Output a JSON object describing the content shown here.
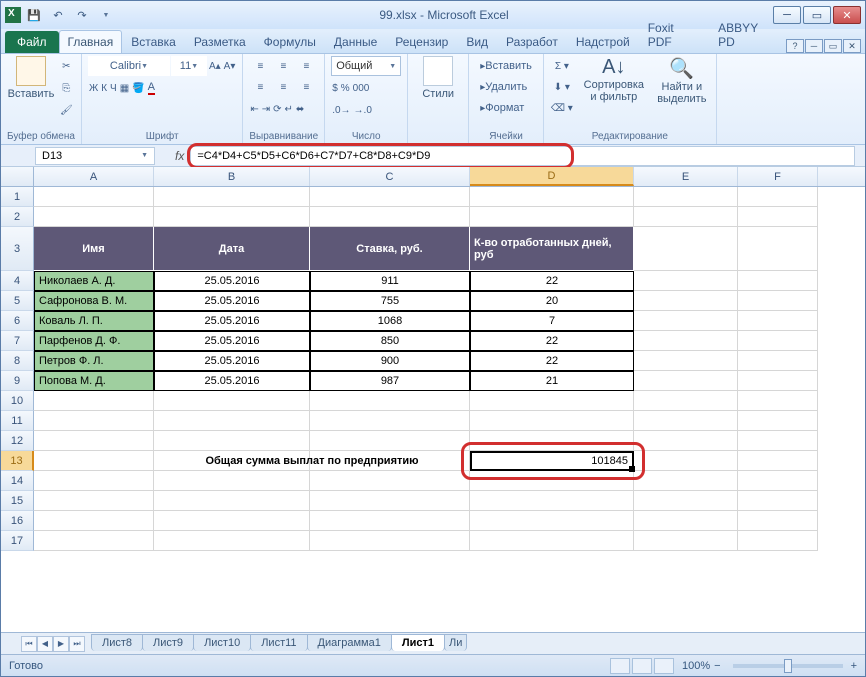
{
  "window": {
    "title": "99.xlsx - Microsoft Excel"
  },
  "qat": {
    "save": "💾",
    "undo": "↶",
    "redo": "↷"
  },
  "ribbon": {
    "file": "Файл",
    "tabs": [
      "Главная",
      "Вставка",
      "Разметка",
      "Формулы",
      "Данные",
      "Рецензир",
      "Вид",
      "Разработ",
      "Надстрой",
      "Foxit PDF",
      "ABBYY PD"
    ],
    "active": "Главная",
    "clipboard": {
      "paste": "Вставить",
      "label": "Буфер обмена"
    },
    "font": {
      "name": "Calibri",
      "size": "11",
      "label": "Шрифт",
      "bold": "Ж",
      "italic": "К",
      "under": "Ч"
    },
    "align": {
      "label": "Выравнивание"
    },
    "number": {
      "format": "Общий",
      "label": "Число"
    },
    "styles": {
      "btn": "Стили",
      "label": ""
    },
    "cells": {
      "insert": "Вставить",
      "delete": "Удалить",
      "format": "Формат",
      "label": "Ячейки"
    },
    "editing": {
      "sort": "Сортировка и фильтр",
      "find": "Найти и выделить",
      "label": "Редактирование"
    }
  },
  "namebox": "D13",
  "formula": "=C4*D4+C5*D5+C6*D6+C7*D7+C8*D8+C9*D9",
  "columns": [
    "A",
    "B",
    "C",
    "D",
    "E",
    "F"
  ],
  "table": {
    "headers": {
      "a": "Имя",
      "b": "Дата",
      "c": "Ставка, руб.",
      "d": "К-во отработанных дней, руб"
    },
    "rows": [
      {
        "a": "Николаев А. Д.",
        "b": "25.05.2016",
        "c": "911",
        "d": "22"
      },
      {
        "a": "Сафронова В. М.",
        "b": "25.05.2016",
        "c": "755",
        "d": "20"
      },
      {
        "a": "Коваль Л. П.",
        "b": "25.05.2016",
        "c": "1068",
        "d": "7"
      },
      {
        "a": "Парфенов Д. Ф.",
        "b": "25.05.2016",
        "c": "850",
        "d": "22"
      },
      {
        "a": "Петров Ф. Л.",
        "b": "25.05.2016",
        "c": "900",
        "d": "22"
      },
      {
        "a": "Попова М. Д.",
        "b": "25.05.2016",
        "c": "987",
        "d": "21"
      }
    ],
    "total_label": "Общая сумма выплат по предприятию",
    "total_value": "101845"
  },
  "sheets": {
    "tabs": [
      "Лист8",
      "Лист9",
      "Лист10",
      "Лист11",
      "Диаграмма1",
      "Лист1"
    ],
    "active": "Лист1",
    "more": "Ли"
  },
  "status": {
    "ready": "Готово",
    "zoom": "100%"
  }
}
